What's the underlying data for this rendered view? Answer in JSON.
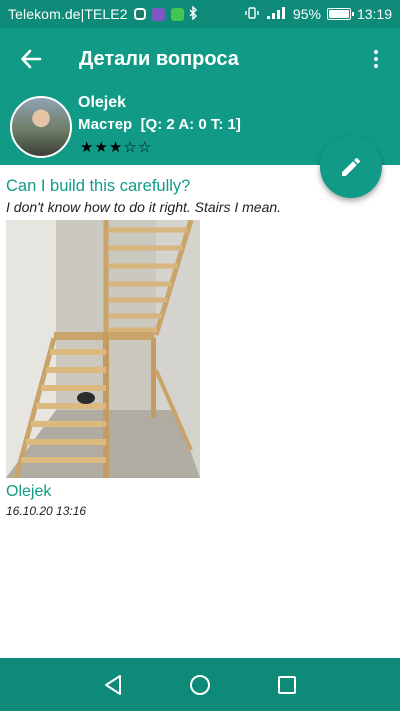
{
  "status_bar": {
    "carrier": "Telekom.de|TELE2",
    "battery_percent": "95%",
    "time": "13:19"
  },
  "app_bar": {
    "title": "Детали вопроса"
  },
  "user": {
    "name": "Olejek",
    "rank": "Мастер",
    "stats": "[Q: 2 A: 0 T: 1]",
    "rating_stars": 3,
    "rating_max": 5
  },
  "question": {
    "title": "Can I build this carefully?",
    "body": "I don't know how to do it right. Stairs I mean.",
    "author": "Olejek",
    "date": "16.10.20 13:16"
  },
  "colors": {
    "primary": "#119b86",
    "primary_dark": "#0d8a78"
  }
}
